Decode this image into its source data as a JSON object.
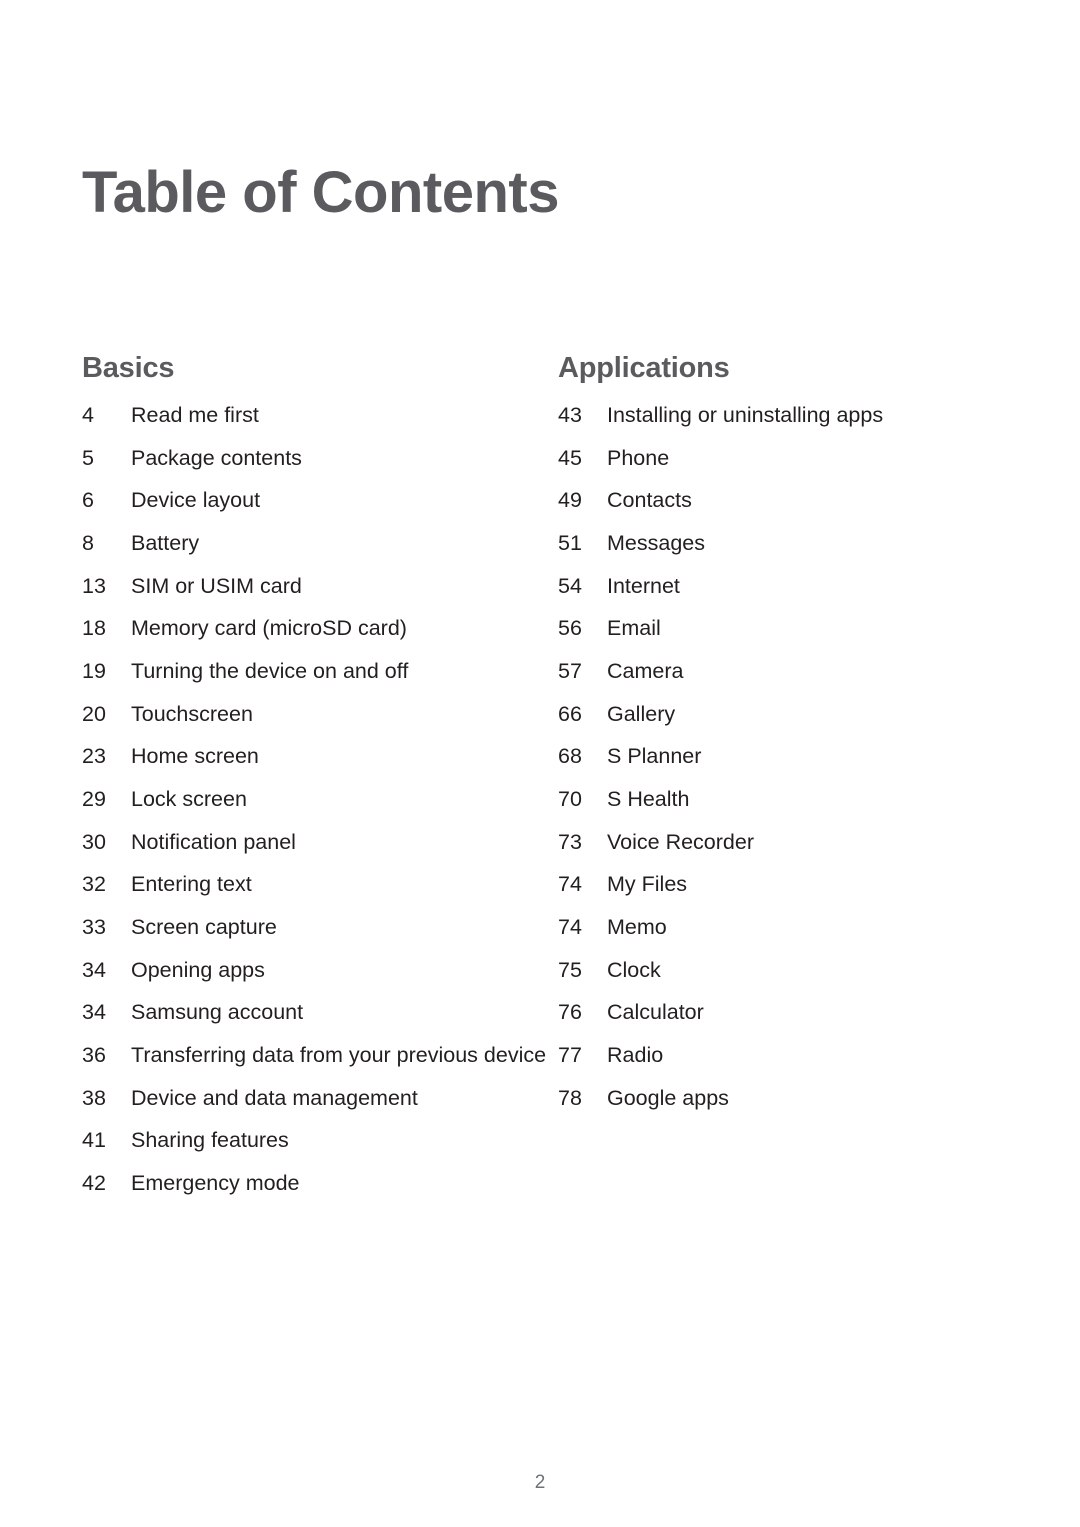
{
  "document": {
    "title": "Table of Contents",
    "page_number": "2",
    "colors": {
      "heading": "#5b5b5f",
      "body_text": "#231f20",
      "page_number": "#6e7275",
      "background": "#ffffff"
    }
  },
  "sections": [
    {
      "heading": "Basics",
      "entries": [
        {
          "page": "4",
          "label": "Read me first"
        },
        {
          "page": "5",
          "label": "Package contents"
        },
        {
          "page": "6",
          "label": "Device layout"
        },
        {
          "page": "8",
          "label": "Battery"
        },
        {
          "page": "13",
          "label": "SIM or USIM card"
        },
        {
          "page": "18",
          "label": "Memory card (microSD card)"
        },
        {
          "page": "19",
          "label": "Turning the device on and off"
        },
        {
          "page": "20",
          "label": "Touchscreen"
        },
        {
          "page": "23",
          "label": "Home screen"
        },
        {
          "page": "29",
          "label": "Lock screen"
        },
        {
          "page": "30",
          "label": "Notification panel"
        },
        {
          "page": "32",
          "label": "Entering text"
        },
        {
          "page": "33",
          "label": "Screen capture"
        },
        {
          "page": "34",
          "label": "Opening apps"
        },
        {
          "page": "34",
          "label": "Samsung account"
        },
        {
          "page": "36",
          "label": "Transferring data from your previous device"
        },
        {
          "page": "38",
          "label": "Device and data management"
        },
        {
          "page": "41",
          "label": "Sharing features"
        },
        {
          "page": "42",
          "label": "Emergency mode"
        }
      ]
    },
    {
      "heading": "Applications",
      "entries": [
        {
          "page": "43",
          "label": "Installing or uninstalling apps"
        },
        {
          "page": "45",
          "label": "Phone"
        },
        {
          "page": "49",
          "label": "Contacts"
        },
        {
          "page": "51",
          "label": "Messages"
        },
        {
          "page": "54",
          "label": "Internet"
        },
        {
          "page": "56",
          "label": "Email"
        },
        {
          "page": "57",
          "label": "Camera"
        },
        {
          "page": "66",
          "label": "Gallery"
        },
        {
          "page": "68",
          "label": "S Planner"
        },
        {
          "page": "70",
          "label": "S Health"
        },
        {
          "page": "73",
          "label": "Voice Recorder"
        },
        {
          "page": "74",
          "label": "My Files"
        },
        {
          "page": "74",
          "label": "Memo"
        },
        {
          "page": "75",
          "label": "Clock"
        },
        {
          "page": "76",
          "label": "Calculator"
        },
        {
          "page": "77",
          "label": "Radio"
        },
        {
          "page": "78",
          "label": "Google apps"
        }
      ]
    }
  ]
}
